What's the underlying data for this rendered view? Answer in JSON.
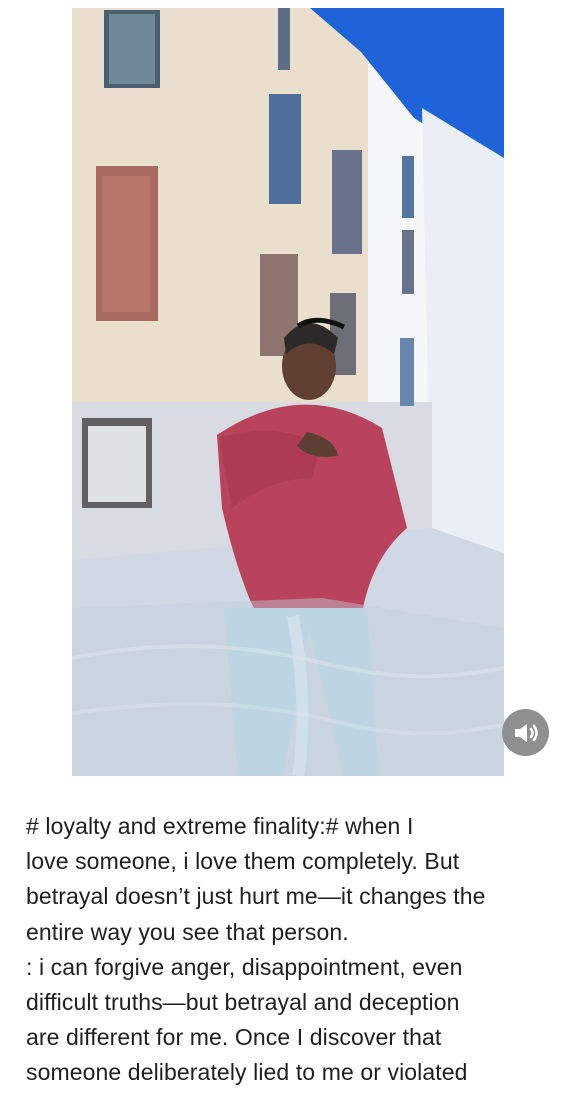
{
  "post": {
    "image": {
      "alt": ""
    },
    "sound_button": {
      "icon": "speaker-icon",
      "state": "on"
    },
    "caption_lines": [
      "# loyalty and extreme finality:# when I",
      "love someone, i love them completely. But",
      "betrayal doesn’t just hurt me—it changes the",
      "entire way you see that person.",
      ": i can forgive anger, disappointment, even",
      "difficult truths—but betrayal and deception",
      "are different for me. Once I discover that",
      "someone deliberately lied to me  or violated"
    ]
  },
  "colors": {
    "wall": "#eadfcd",
    "sky": "#f1f3f6",
    "roof": "#1f63d9",
    "hoodie": "#b9435c",
    "jeans": "#b9d9ea",
    "paving": "#cfd8e3",
    "sound_button": "#8f8f8f",
    "text": "#1f1f1f"
  }
}
